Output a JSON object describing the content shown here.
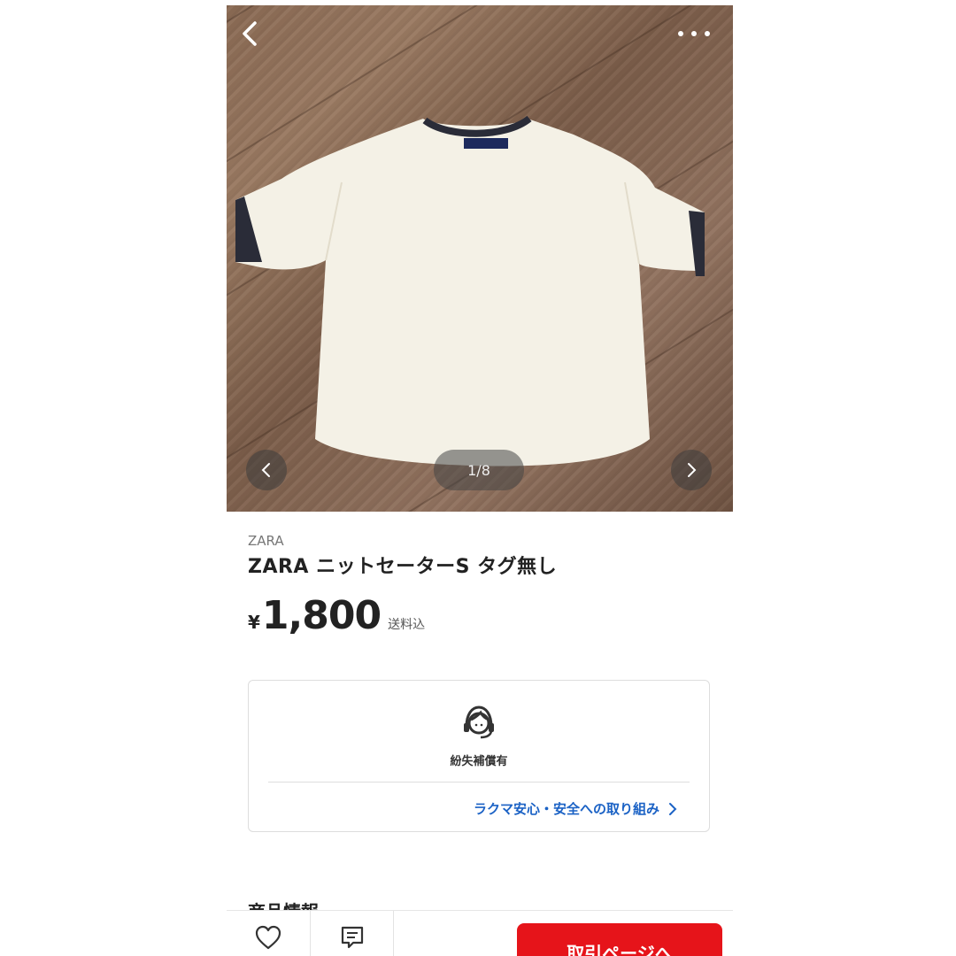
{
  "gallery": {
    "counter": "1/8",
    "back_icon": "chevron-left-icon",
    "more_icon": "more-dots-icon",
    "prev_icon": "chevron-left-icon",
    "next_icon": "chevron-right-icon"
  },
  "product": {
    "brand": "ZARA",
    "title": "ZARA ニットセーターS タグ無し",
    "currency": "¥",
    "price": "1,800",
    "shipping_note": "送料込"
  },
  "guarantee": {
    "icon": "support-agent-icon",
    "label": "紛失補償有",
    "link": "ラクマ安心・安全への取り組み"
  },
  "section": {
    "title": "商品情報"
  },
  "bottom_bar": {
    "like_icon": "heart-icon",
    "comment_icon": "comment-icon",
    "buy_label": "取引ページへ"
  },
  "colors": {
    "accent_red": "#e6141a",
    "link_blue": "#1b62c5"
  }
}
